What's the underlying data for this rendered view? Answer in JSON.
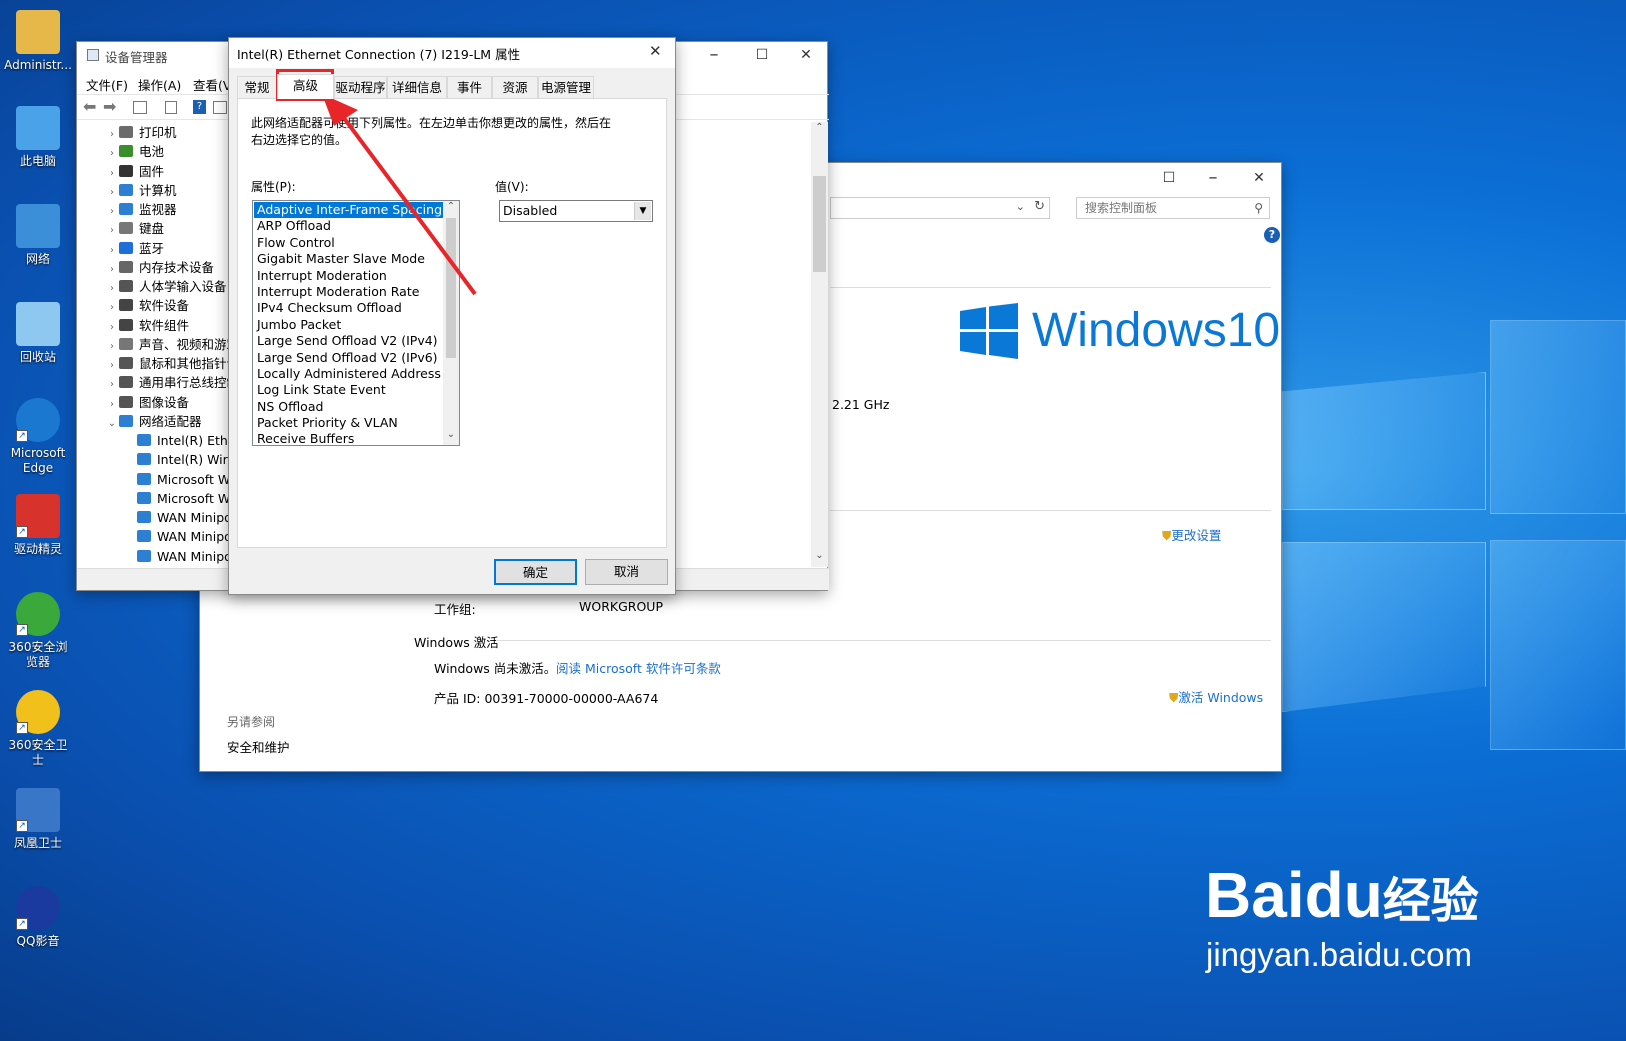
{
  "desktop": {
    "icons": [
      {
        "label": "Administr..."
      },
      {
        "label": "此电脑"
      },
      {
        "label": "网络"
      },
      {
        "label": "回收站"
      },
      {
        "label": "Microsoft Edge"
      },
      {
        "label": "驱动精灵"
      },
      {
        "label": "360安全浏览器"
      },
      {
        "label": "360安全卫士"
      },
      {
        "label": "凤凰卫士"
      },
      {
        "label": "QQ影音"
      }
    ]
  },
  "device_manager": {
    "title": "设备管理器",
    "menu": [
      "文件(F)",
      "操作(A)",
      "查看(V"
    ],
    "tree": [
      {
        "label": "打印机",
        "expander": "›",
        "color": "#6b6b6b"
      },
      {
        "label": "电池",
        "expander": "›",
        "color": "#3a8f2c"
      },
      {
        "label": "固件",
        "expander": "›",
        "color": "#333333"
      },
      {
        "label": "计算机",
        "expander": "›",
        "color": "#2d7fd3"
      },
      {
        "label": "监视器",
        "expander": "›",
        "color": "#2d7fd3"
      },
      {
        "label": "键盘",
        "expander": "›",
        "color": "#777777"
      },
      {
        "label": "蓝牙",
        "expander": "›",
        "color": "#1e6fd9"
      },
      {
        "label": "内存技术设备",
        "expander": "›",
        "color": "#666666"
      },
      {
        "label": "人体学输入设备",
        "expander": "›",
        "color": "#555555"
      },
      {
        "label": "软件设备",
        "expander": "›",
        "color": "#444444"
      },
      {
        "label": "软件组件",
        "expander": "›",
        "color": "#444444"
      },
      {
        "label": "声音、视频和游戏",
        "expander": "›",
        "color": "#777777"
      },
      {
        "label": "鼠标和其他指针设",
        "expander": "›",
        "color": "#555555"
      },
      {
        "label": "通用串行总线控制",
        "expander": "›",
        "color": "#555555"
      },
      {
        "label": "图像设备",
        "expander": "›",
        "color": "#555555"
      },
      {
        "label": "网络适配器",
        "expander": "⌄",
        "color": "#2d7fd3"
      },
      {
        "label": "Intel(R) Ether",
        "expander": "",
        "color": "#2d7fd3"
      },
      {
        "label": "Intel(R) Wirel",
        "expander": "",
        "color": "#2d7fd3"
      },
      {
        "label": "Microsoft Wi",
        "expander": "",
        "color": "#2d7fd3"
      },
      {
        "label": "Microsoft Wi",
        "expander": "",
        "color": "#2d7fd3"
      },
      {
        "label": "WAN Minipo",
        "expander": "",
        "color": "#2d7fd3"
      },
      {
        "label": "WAN Minipo",
        "expander": "",
        "color": "#2d7fd3"
      },
      {
        "label": "WAN Minipo",
        "expander": "",
        "color": "#2d7fd3"
      }
    ]
  },
  "system_window": {
    "search_placeholder": "搜索控制面板",
    "windows_logo_text": "Windows",
    "windows_logo_version": "10",
    "cpu_speed": "2.21 GHz",
    "change_settings": "更改设置",
    "workgroup_label": "工作组:",
    "workgroup_value": "WORKGROUP",
    "activation_header": "Windows 激活",
    "activation_status": "Windows 尚未激活。",
    "license_link": "阅读 Microsoft 软件许可条款",
    "product_id": "产品 ID: 00391-70000-00000-AA674",
    "activate_link": "激活 Windows",
    "see_also": "另请参阅",
    "security_link": "安全和维护"
  },
  "dialog": {
    "title": "Intel(R) Ethernet Connection (7) I219-LM 属性",
    "tabs": [
      "常规",
      "高级",
      "驱动程序",
      "详细信息",
      "事件",
      "资源",
      "电源管理"
    ],
    "active_tab": "高级",
    "description": "此网络适配器可使用下列属性。在左边单击你想更改的属性，然后在右边选择它的值。",
    "property_label": "属性(P):",
    "value_label": "值(V):",
    "value_selected": "Disabled",
    "properties": [
      "Adaptive Inter-Frame Spacing",
      "ARP Offload",
      "Flow Control",
      "Gigabit Master Slave Mode",
      "Interrupt Moderation",
      "Interrupt Moderation Rate",
      "IPv4 Checksum Offload",
      "Jumbo Packet",
      "Large Send Offload V2 (IPv4)",
      "Large Send Offload V2 (IPv6)",
      "Locally Administered Address",
      "Log Link State Event",
      "NS Offload",
      "Packet Priority & VLAN",
      "Receive Buffers"
    ],
    "selected_property": "Adaptive Inter-Frame Spacing",
    "ok_label": "确定",
    "cancel_label": "取消"
  },
  "watermark": {
    "brand": "Bai",
    "brand_du": "du",
    "suffix": "经验",
    "url": "jingyan.baidu.com"
  },
  "colors": {
    "accent": "#0078d7",
    "highlight_box": "#e8262a",
    "link": "#1a6fd1"
  }
}
